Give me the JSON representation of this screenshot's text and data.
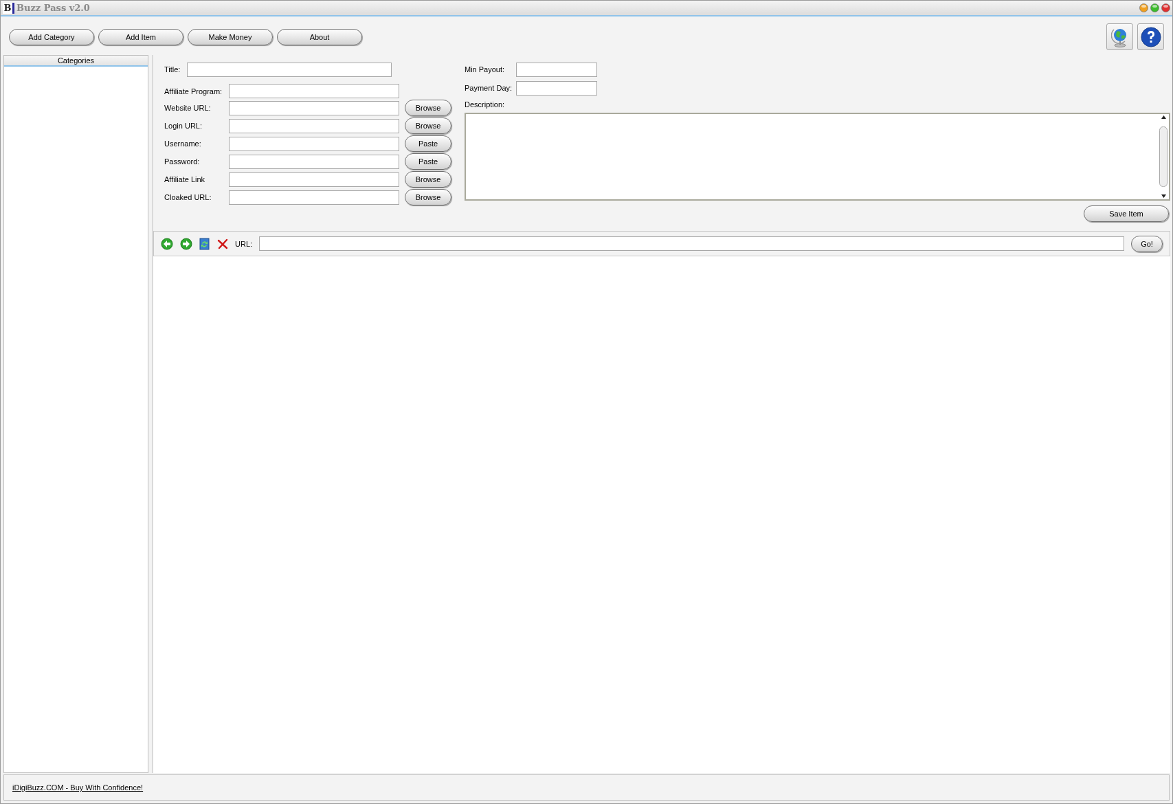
{
  "window": {
    "logo": "B",
    "title": "Buzz Pass v2.0"
  },
  "toolbar": {
    "buttons": [
      "Add Category",
      "Add Item",
      "Make Money",
      "About"
    ]
  },
  "sidebar": {
    "header": "Categories"
  },
  "form": {
    "title_label": "Title:",
    "fields": [
      {
        "label": "Affiliate Program:"
      },
      {
        "label": "Website URL:",
        "button": "Browse"
      },
      {
        "label": "Login URL:",
        "button": "Browse"
      },
      {
        "label": "Username:",
        "button": "Paste"
      },
      {
        "label": "Password:",
        "button": "Paste"
      },
      {
        "label": "Affiliate Link",
        "button": "Browse"
      },
      {
        "label": "Cloaked URL:",
        "button": "Browse"
      }
    ],
    "min_payout_label": "Min Payout:",
    "payment_day_label": "Payment Day:",
    "description_label": "Description:",
    "save_button": "Save Item"
  },
  "browser": {
    "url_label": "URL:",
    "go_button": "Go!"
  },
  "footer": {
    "link": "iDigiBuzz.COM - Buy With Confidence!"
  }
}
